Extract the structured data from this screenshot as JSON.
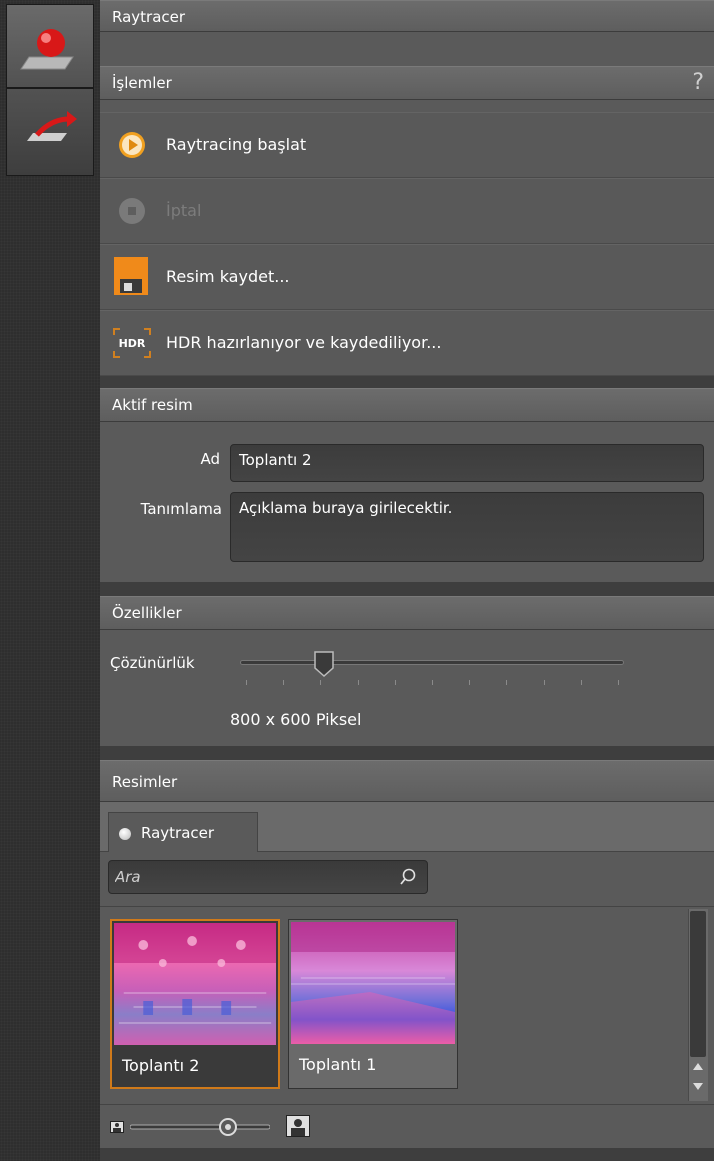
{
  "sidebar": {
    "tabs": [
      {
        "icon": "raytracer-sphere-icon",
        "active": true
      },
      {
        "icon": "export-arrow-icon",
        "active": false
      }
    ]
  },
  "panel": {
    "title": "Raytracer",
    "actions": {
      "header": "İşlemler",
      "help": "?",
      "items": [
        {
          "label": "Raytracing başlat",
          "icon": "play-icon",
          "enabled": true
        },
        {
          "label": "İptal",
          "icon": "stop-icon",
          "enabled": false
        },
        {
          "label": "Resim kaydet...",
          "icon": "save-icon",
          "enabled": true
        },
        {
          "label": "HDR hazırlanıyor ve kaydediliyor...",
          "icon": "hdr-icon",
          "enabled": true
        }
      ]
    },
    "active_image": {
      "header": "Aktif resim",
      "name_label": "Ad",
      "name_value": "Toplantı 2",
      "desc_label": "Tanımlama",
      "desc_value": "Açıklama buraya girilecektir."
    },
    "properties": {
      "header": "Özellikler",
      "resolution_label": "Çözünürlük",
      "resolution_value": "800 x 600",
      "resolution_unit": "Piksel",
      "slider_fraction": 0.22
    },
    "images": {
      "header": "Resimler",
      "tab_label": "Raytracer",
      "search_placeholder": "Ara",
      "thumbnails": [
        {
          "caption": "Toplantı 2",
          "selected": true
        },
        {
          "caption": "Toplantı 1",
          "selected": false
        }
      ]
    }
  },
  "colors": {
    "accent_orange": "#d07a1a",
    "play_orange": "#f0a020"
  }
}
